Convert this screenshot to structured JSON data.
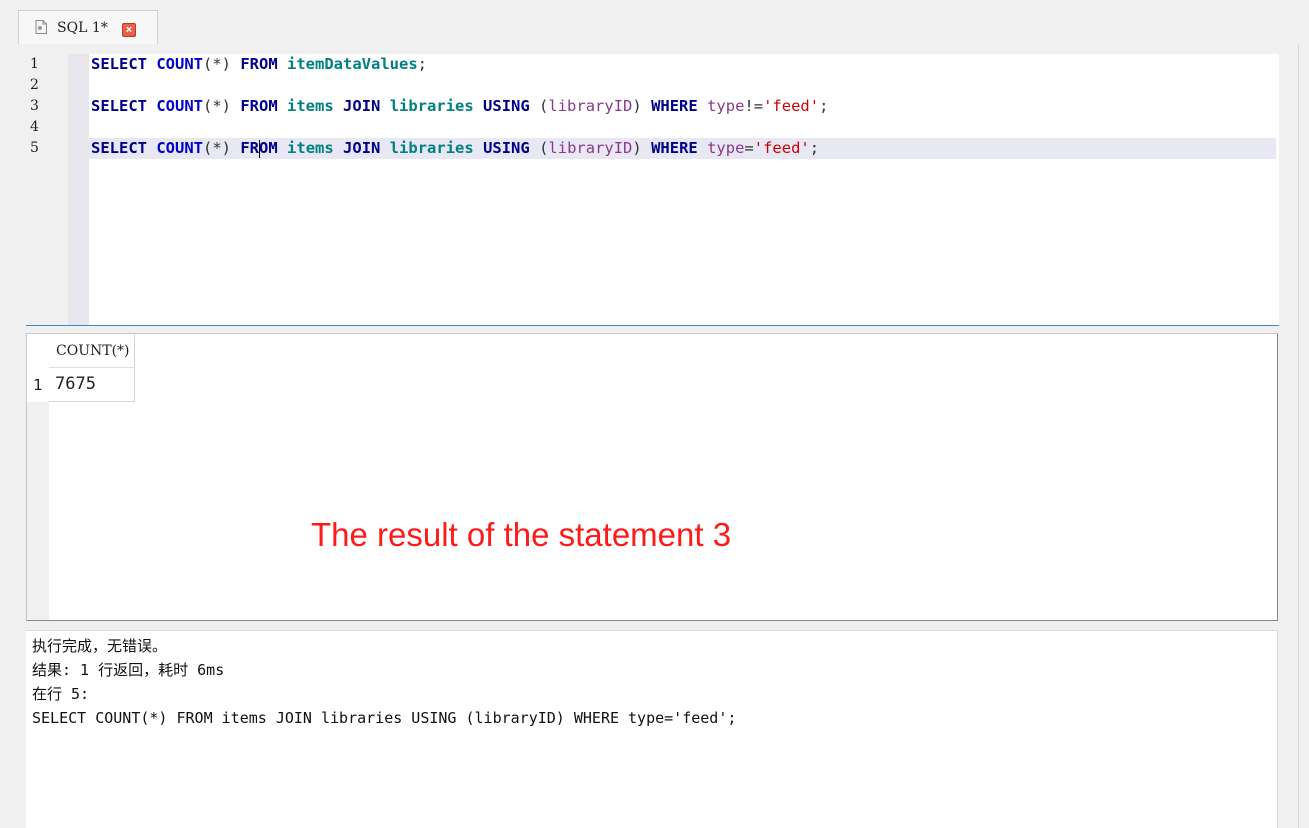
{
  "tab": {
    "title": "SQL 1*",
    "close_glyph": "×",
    "icon": "document-icon"
  },
  "editor": {
    "line_numbers": [
      "1",
      "2",
      "3",
      "4",
      "5"
    ],
    "current_line": 5,
    "lines": [
      [
        {
          "t": "SELECT",
          "c": "kw"
        },
        {
          "t": " ",
          "c": "pn"
        },
        {
          "t": "COUNT",
          "c": "fn"
        },
        {
          "t": "(*) ",
          "c": "pn"
        },
        {
          "t": "FROM",
          "c": "kw"
        },
        {
          "t": " ",
          "c": "pn"
        },
        {
          "t": "itemDataValues",
          "c": "tbl"
        },
        {
          "t": ";",
          "c": "pn"
        }
      ],
      [],
      [
        {
          "t": "SELECT",
          "c": "kw"
        },
        {
          "t": " ",
          "c": "pn"
        },
        {
          "t": "COUNT",
          "c": "fn"
        },
        {
          "t": "(*) ",
          "c": "pn"
        },
        {
          "t": "FROM",
          "c": "kw"
        },
        {
          "t": " ",
          "c": "pn"
        },
        {
          "t": "items",
          "c": "tbl"
        },
        {
          "t": " ",
          "c": "pn"
        },
        {
          "t": "JOIN",
          "c": "kw"
        },
        {
          "t": " ",
          "c": "pn"
        },
        {
          "t": "libraries",
          "c": "tbl"
        },
        {
          "t": " ",
          "c": "pn"
        },
        {
          "t": "USING",
          "c": "kw"
        },
        {
          "t": " (",
          "c": "pn"
        },
        {
          "t": "libraryID",
          "c": "col"
        },
        {
          "t": ") ",
          "c": "pn"
        },
        {
          "t": "WHERE",
          "c": "kw"
        },
        {
          "t": " ",
          "c": "pn"
        },
        {
          "t": "type",
          "c": "col"
        },
        {
          "t": "!=",
          "c": "pn"
        },
        {
          "t": "'feed'",
          "c": "str"
        },
        {
          "t": ";",
          "c": "pn"
        }
      ],
      [],
      [
        {
          "t": "SELECT",
          "c": "kw"
        },
        {
          "t": " ",
          "c": "pn"
        },
        {
          "t": "COUNT",
          "c": "fn"
        },
        {
          "t": "(*) ",
          "c": "pn"
        },
        {
          "t": "FR",
          "c": "kw"
        },
        {
          "caret": true
        },
        {
          "t": "OM",
          "c": "kw"
        },
        {
          "t": " ",
          "c": "pn"
        },
        {
          "t": "items",
          "c": "tbl"
        },
        {
          "t": " ",
          "c": "pn"
        },
        {
          "t": "JOIN",
          "c": "kw"
        },
        {
          "t": " ",
          "c": "pn"
        },
        {
          "t": "libraries",
          "c": "tbl"
        },
        {
          "t": " ",
          "c": "pn"
        },
        {
          "t": "USING",
          "c": "kw"
        },
        {
          "t": " (",
          "c": "pn"
        },
        {
          "t": "libraryID",
          "c": "col"
        },
        {
          "t": ") ",
          "c": "pn"
        },
        {
          "t": "WHERE",
          "c": "kw"
        },
        {
          "t": " ",
          "c": "pn"
        },
        {
          "t": "type",
          "c": "col"
        },
        {
          "t": "=",
          "c": "pn"
        },
        {
          "t": "'feed'",
          "c": "str"
        },
        {
          "t": ";",
          "c": "pn"
        }
      ]
    ],
    "colors": {
      "keyword": "#00008b",
      "function": "#0000cd",
      "table": "#008080",
      "column": "#8b3a8b",
      "string": "#cc0000",
      "current_line_bg": "#e8e8f4"
    }
  },
  "result_grid": {
    "columns": [
      "COUNT(*)"
    ],
    "rows": [
      {
        "num": "1",
        "values": [
          "7675"
        ]
      }
    ]
  },
  "annotation": {
    "text": "The result of the statement 3",
    "color": "#ff1a1a"
  },
  "messages": [
    "执行完成，无错误。",
    "结果: 1 行返回，耗时 6ms",
    "在行 5:",
    "SELECT COUNT(*) FROM items JOIN libraries USING (libraryID) WHERE type='feed';"
  ]
}
